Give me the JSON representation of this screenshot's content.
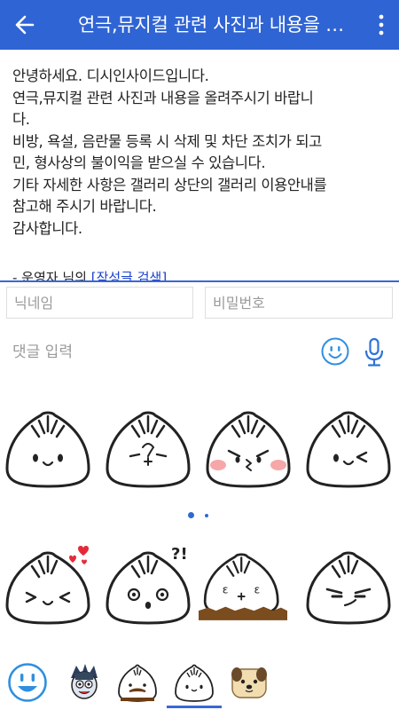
{
  "appbar": {
    "title": "연극,뮤지컬 관련 사진과 내용을 올려주시기 바랍니다",
    "back_icon": "arrow-left-icon",
    "more_icon": "more-vertical-icon",
    "color": "#2f64d4"
  },
  "notice": {
    "lines": [
      "안녕하세요. 디시인사이드입니다.",
      "연극,뮤지컬 관련 사진과 내용을 올려주시기 바랍니",
      "다.",
      "비방, 욕설, 음란물 등록 시 삭제 및 차단 조치가 되고",
      "민, 형사상의 불이익을 받으실 수 있습니다.",
      "기타 자세한 사항은 갤러리 상단의 갤러리 이용안내를",
      "참고해 주시기 바랍니다.",
      "감사합니다."
    ],
    "link_prefix": "- 운영자 님의 ",
    "link_text": "[작성글 검색]"
  },
  "form": {
    "nickname_placeholder": "닉네임",
    "password_placeholder": "비밀번호",
    "comment_placeholder": "댓글 입력",
    "emoji_icon": "smiley-icon",
    "mic_icon": "microphone-icon"
  },
  "stickers": {
    "row1": [
      "dumpling-smile",
      "dumpling-mustache",
      "dumpling-blush-kiss",
      "dumpling-wink"
    ],
    "row2": [
      "dumpling-hearts",
      "dumpling-question",
      "dumpling-mud",
      "dumpling-smirk"
    ],
    "page_dots": 2,
    "active_page": 1
  },
  "tabs": [
    "smiley-tab",
    "vampire-tab",
    "dumpling-mustache-tab",
    "dumpling-tab",
    "puppy-tab"
  ],
  "active_tab": 3,
  "accent": "#3a67d6"
}
